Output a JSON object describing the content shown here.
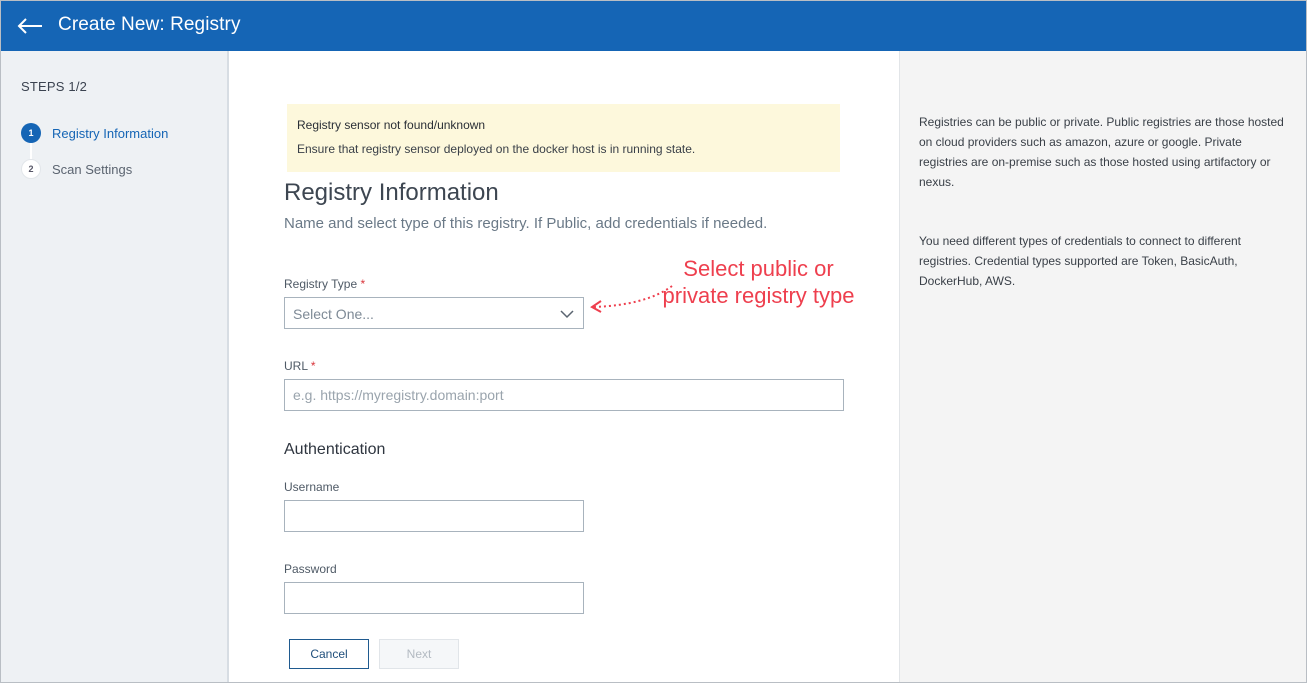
{
  "header": {
    "title": "Create New: Registry",
    "back_icon": "arrow-left-icon",
    "background": "#1565b5"
  },
  "sidebar": {
    "steps_title": "STEPS 1/2",
    "steps": [
      {
        "number": "1",
        "label": "Registry Information",
        "active": true
      },
      {
        "number": "2",
        "label": "Scan Settings",
        "active": false
      }
    ]
  },
  "alert": {
    "title": "Registry sensor not found/unknown",
    "body": "Ensure that registry sensor deployed on the docker host is in running state."
  },
  "form": {
    "title": "Registry Information",
    "subtitle": "Name and select type of this registry. If Public, add credentials if needed.",
    "registry_type": {
      "label": "Registry Type",
      "required_mark": "*",
      "value": "Select One...",
      "icon": "chevron-down-icon"
    },
    "url": {
      "label": "URL",
      "required_mark": "*",
      "value": "",
      "placeholder": "e.g. https://myregistry.domain:port"
    },
    "authentication_title": "Authentication",
    "username": {
      "label": "Username",
      "value": ""
    },
    "password": {
      "label": "Password",
      "value": ""
    },
    "cancel_label": "Cancel",
    "next_label": "Next"
  },
  "callout": {
    "text": "Select public or private registry type",
    "color": "#ee3f4e"
  },
  "help": {
    "paragraph_1": "Registries can be public or private. Public registries are those hosted on cloud providers such as amazon, azure or google. Private registries are on-premise such as those hosted using artifactory or nexus.",
    "paragraph_2": "You need different types of credentials to connect to different registries. Credential types supported are Token, BasicAuth, DockerHub, AWS."
  }
}
